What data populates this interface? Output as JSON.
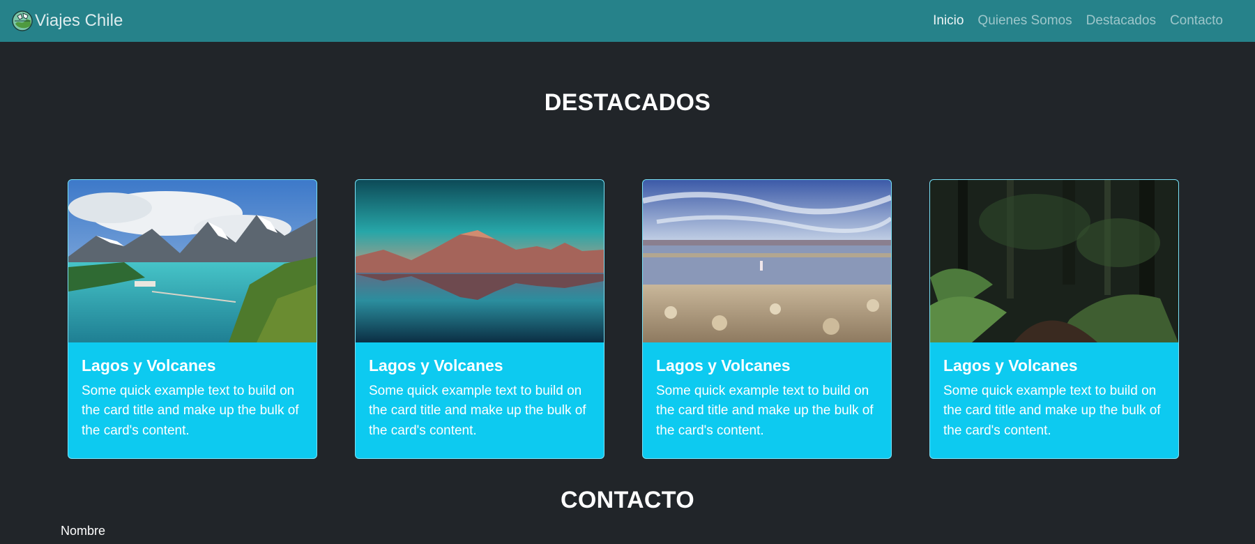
{
  "navbar": {
    "brand": "Viajes Chile",
    "links": [
      "Inicio",
      "Quienes Somos",
      "Destacados",
      "Contacto"
    ],
    "active": "Inicio",
    "background": "#26828a"
  },
  "destacados": {
    "title": "DESTACADOS",
    "cards": [
      {
        "title": "Lagos y Volcanes",
        "text": "Some quick example text to build on the card title and make up the bulk of the card's content."
      },
      {
        "title": "Lagos y Volcanes",
        "text": "Some quick example text to build on the card title and make up the bulk of the card's content."
      },
      {
        "title": "Lagos y Volcanes",
        "text": "Some quick example text to build on the card title and make up the bulk of the card's content."
      },
      {
        "title": "Lagos y Volcanes",
        "text": "Some quick example text to build on the card title and make up the bulk of the card's content."
      }
    ]
  },
  "contacto": {
    "title": "CONTACTO",
    "name_label": "Nombre"
  },
  "colors": {
    "page_background": "#212529",
    "card_body": "#0dcaf0"
  }
}
